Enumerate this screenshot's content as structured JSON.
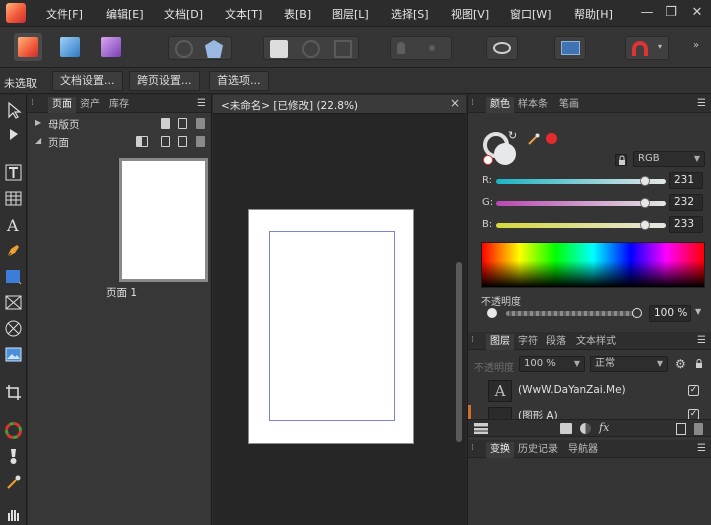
{
  "menubar": {
    "items": [
      "文件[F]",
      "编辑[E]",
      "文档[D]",
      "文本[T]",
      "表[B]",
      "图层[L]",
      "选择[S]",
      "视图[V]",
      "窗口[W]",
      "帮助[H]"
    ],
    "minimize": "—",
    "restore": "❐",
    "close": "✕"
  },
  "context": {
    "selection": "未选取",
    "buttons": [
      "文档设置...",
      "跨页设置...",
      "首选项..."
    ]
  },
  "pages_panel": {
    "tabs": [
      "页面",
      "资产",
      "库存"
    ],
    "master_label": "母版页",
    "pages_label": "页面",
    "thumb_label": "页面 1"
  },
  "document": {
    "title": "<未命名> [已修改] (22.8%)",
    "close": "×"
  },
  "color_panel": {
    "tabs": [
      "颜色",
      "样本条",
      "笔画"
    ],
    "model": "RGB",
    "channels": [
      {
        "label": "R:",
        "value": "231"
      },
      {
        "label": "G:",
        "value": "232"
      },
      {
        "label": "B:",
        "value": "233"
      }
    ],
    "opacity_label": "不透明度",
    "opacity_value": "100 %",
    "accent_red": "#e52b2b"
  },
  "layers_panel": {
    "tabs": [
      "图层",
      "字符",
      "段落",
      "文本样式"
    ],
    "opacity_label": "不透明度",
    "opacity_value": "100 %",
    "blend_mode": "正常",
    "layers": [
      {
        "name": "(WwW.DaYanZai.Me)",
        "thumb": "A",
        "checked": "✓"
      },
      {
        "name": "(图形 A)",
        "checked": "✓"
      }
    ]
  },
  "transform_panel": {
    "tabs": [
      "变换",
      "历史记录",
      "导航器"
    ]
  }
}
